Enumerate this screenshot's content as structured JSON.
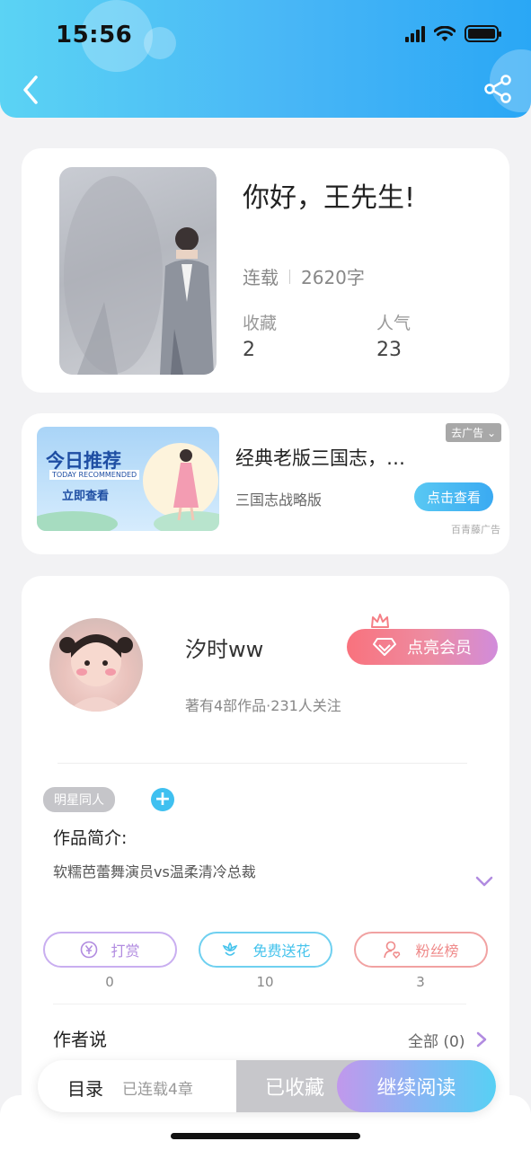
{
  "status_bar": {
    "time": "15:56"
  },
  "book": {
    "title": "你好，王先生!",
    "status": "连载",
    "word_count": "2620字",
    "favorites_label": "收藏",
    "favorites_value": "2",
    "popularity_label": "人气",
    "popularity_value": "23"
  },
  "ad": {
    "banner_heading": "今日推荐",
    "banner_sub": "TODAY RECOMMENDED",
    "banner_cta": "立即查看",
    "title": "经典老版三国志，…",
    "description": "三国志战略版",
    "close_label": "去广告",
    "button_label": "点击查看",
    "source": "百青藤广告"
  },
  "author": {
    "name": "汐时ww",
    "meta": "著有4部作品·231人关注",
    "vip_button": "点亮会员",
    "tag": "明星同人",
    "intro_label": "作品简介:",
    "intro_text": "软糯芭蕾舞演员vs温柔清冷总裁"
  },
  "actions": [
    {
      "label": "打赏",
      "count": "0",
      "color": "#b18be0"
    },
    {
      "label": "免费送花",
      "count": "10",
      "color": "#45c3ec"
    },
    {
      "label": "粉丝榜",
      "count": "3",
      "color": "#ef8a8a"
    }
  ],
  "author_says": {
    "label": "作者说",
    "all": "全部 (0)"
  },
  "bottom_bar": {
    "toc_label": "目录",
    "toc_status": "已连载4章",
    "favorited_label": "已收藏",
    "continue_label": "继续阅读"
  },
  "colors": {
    "header_start": "#5bd3f4",
    "header_end": "#2aa7f5",
    "accent_blue": "#3fc0f0",
    "vip_start": "#f9727d",
    "vip_end": "#d18cdb"
  }
}
